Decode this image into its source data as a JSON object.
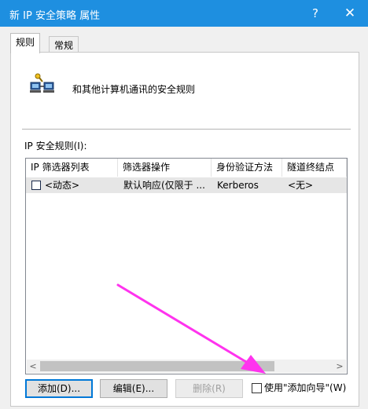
{
  "window": {
    "title": "新 IP 安全策略 属性",
    "help_label": "?",
    "close_label": "✕"
  },
  "tabs": [
    {
      "label": "规则",
      "active": true
    },
    {
      "label": "常规",
      "active": false
    }
  ],
  "header": {
    "icon": "network-computers-icon",
    "text": "和其他计算机通讯的安全规则"
  },
  "rules": {
    "label": "IP 安全规则(I):",
    "columns": [
      "IP 筛选器列表",
      "筛选器操作",
      "身份验证方法",
      "隧道终结点"
    ],
    "rows": [
      {
        "checked": false,
        "filter_list": "<动态>",
        "filter_action": "默认响应(仅限于 ...",
        "auth_method": "Kerberos",
        "tunnel_endpoint": "<无>"
      }
    ],
    "scroll_left_label": "<",
    "scroll_right_label": ">"
  },
  "buttons": {
    "add": "添加(D)...",
    "edit": "编辑(E)...",
    "remove": "删除(R)"
  },
  "wizard": {
    "checked": false,
    "label": "使用\"添加向导\"(W)"
  },
  "colors": {
    "titlebar": "#1e8fe0",
    "arrow": "#ff33ee",
    "default_button_border": "#0078d7"
  }
}
